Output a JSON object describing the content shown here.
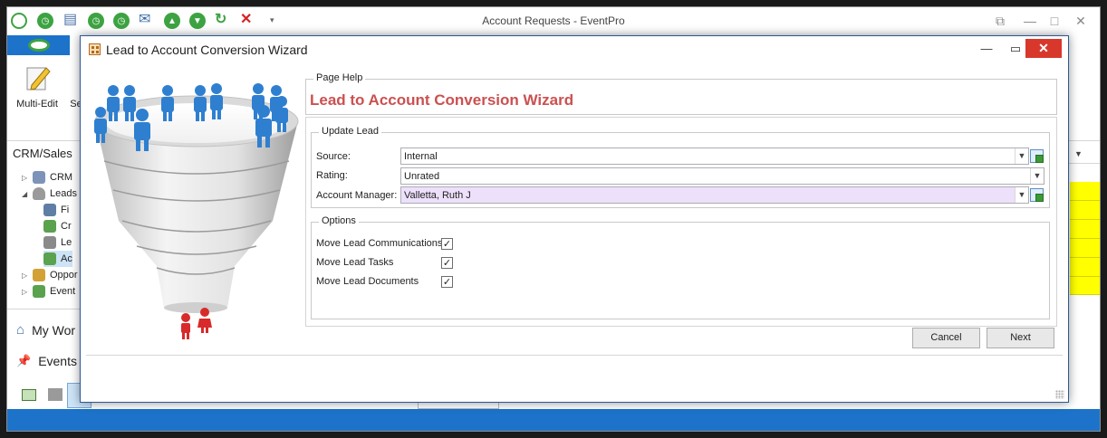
{
  "app": {
    "title": "Account Requests - EventPro",
    "ribbon": {
      "multi_edit": "Multi-Edit",
      "second_partial": "Se"
    },
    "nav": {
      "header": "CRM/Sales",
      "tree": [
        {
          "label": "CRM"
        },
        {
          "label": "Leads"
        },
        {
          "label": "Fi"
        },
        {
          "label": "Cr"
        },
        {
          "label": "Le"
        },
        {
          "label": "Ac"
        },
        {
          "label": "Oppor"
        },
        {
          "label": "Event"
        }
      ],
      "my_work": "My Wor",
      "events": "Events"
    }
  },
  "dialog": {
    "title": "Lead to Account Conversion Wizard",
    "page_help": {
      "legend": "Page Help",
      "heading": "Lead to Account Conversion Wizard"
    },
    "update_lead": {
      "legend": "Update Lead",
      "source_label": "Source:",
      "source_value": "Internal",
      "rating_label": "Rating:",
      "rating_value": "Unrated",
      "manager_label": "Account Manager:",
      "manager_value": "Valletta, Ruth J"
    },
    "options": {
      "legend": "Options",
      "items": [
        {
          "label": "Move Lead Communications",
          "checked": true
        },
        {
          "label": "Move Lead Tasks",
          "checked": true
        },
        {
          "label": "Move Lead Documents",
          "checked": true
        }
      ]
    },
    "buttons": {
      "cancel": "Cancel",
      "next": "Next"
    },
    "glyphs": {
      "check": "✓",
      "dropdown": "▼",
      "close": "✕",
      "minimize": "—",
      "maximize": "▭"
    }
  },
  "colors": {
    "accent": "#1c73c9",
    "help_heading": "#cc5050",
    "close_button": "#d8382c",
    "highlight_field": "#ede0fb",
    "grid_yellow": "#ffff00",
    "figures_blue": "#2f7fd0",
    "figures_red": "#d82a2a"
  }
}
